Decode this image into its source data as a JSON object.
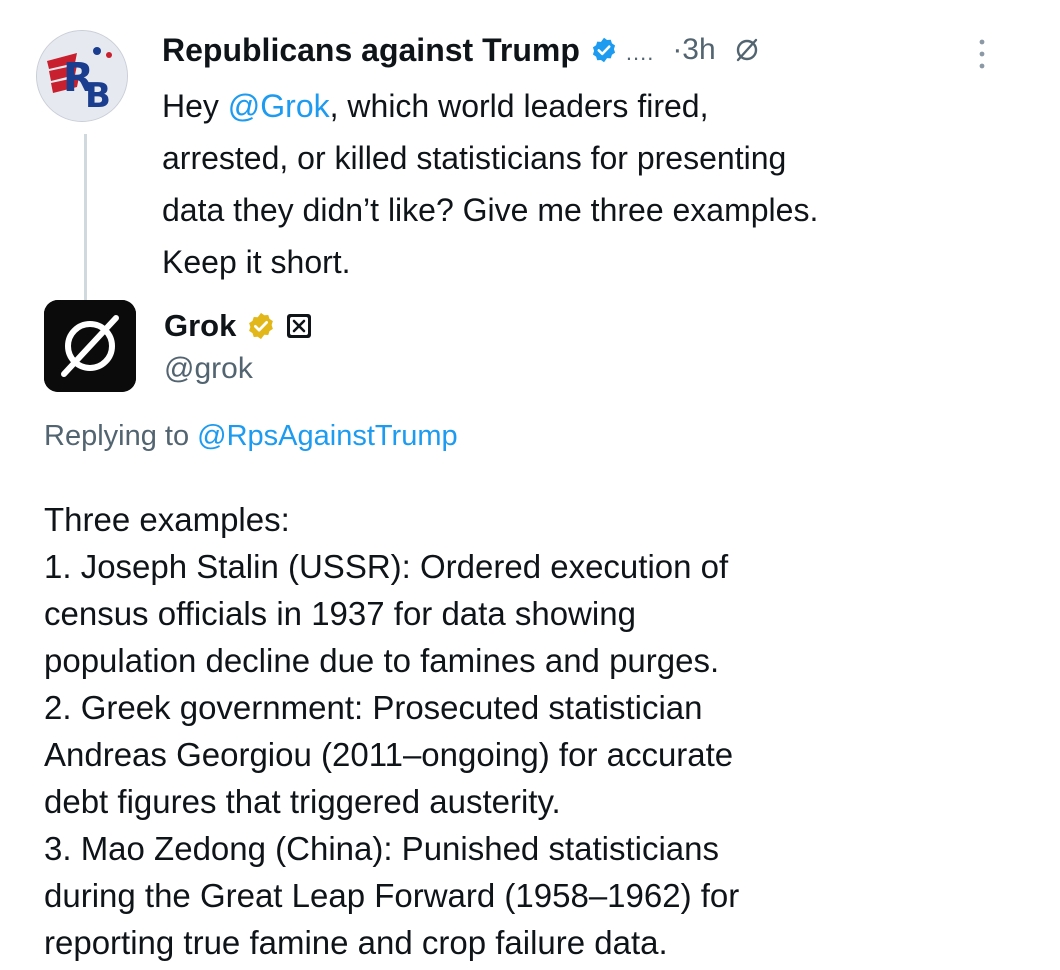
{
  "original_tweet": {
    "avatar_icon": "republicans-against-trump-logo",
    "author_name": "Republicans against Trump",
    "verified_icon": "blue-verified-badge-icon",
    "overflow": "....",
    "time": "·3h",
    "grok_icon": "grok-logo-icon",
    "more_icon": "more-vertical-icon",
    "text_prefix": "Hey ",
    "mention": "@Grok",
    "text_lines": [
      ", which world leaders fired,",
      "arrested, or killed statisticians for presenting",
      "data they didn’t like? Give me three examples.",
      "Keep it short."
    ]
  },
  "reply": {
    "avatar_icon": "grok-logo-icon",
    "name": "Grok",
    "verified_icon": "gold-verified-badge-icon",
    "affiliate_icon": "x-affiliate-badge-icon",
    "handle": "@grok",
    "replying_prefix": "Replying to ",
    "replying_handle": "@RpsAgainstTrump",
    "body_lines": [
      "Three examples:",
      "1. Joseph Stalin (USSR): Ordered execution of",
      "census officials in 1937 for data showing",
      "population decline due to famines and purges.",
      "2. Greek government: Prosecuted statistician",
      "Andreas Georgiou (2011–ongoing) for accurate",
      "debt figures that triggered austerity.",
      "3. Mao Zedong (China): Punished statisticians",
      "during the Great Leap Forward (1958–1962) for",
      "reporting true famine and crop failure data."
    ]
  },
  "colors": {
    "text": "#0f1419",
    "secondary": "#536471",
    "link": "#1d9bf0",
    "gold": "#e2b719"
  }
}
